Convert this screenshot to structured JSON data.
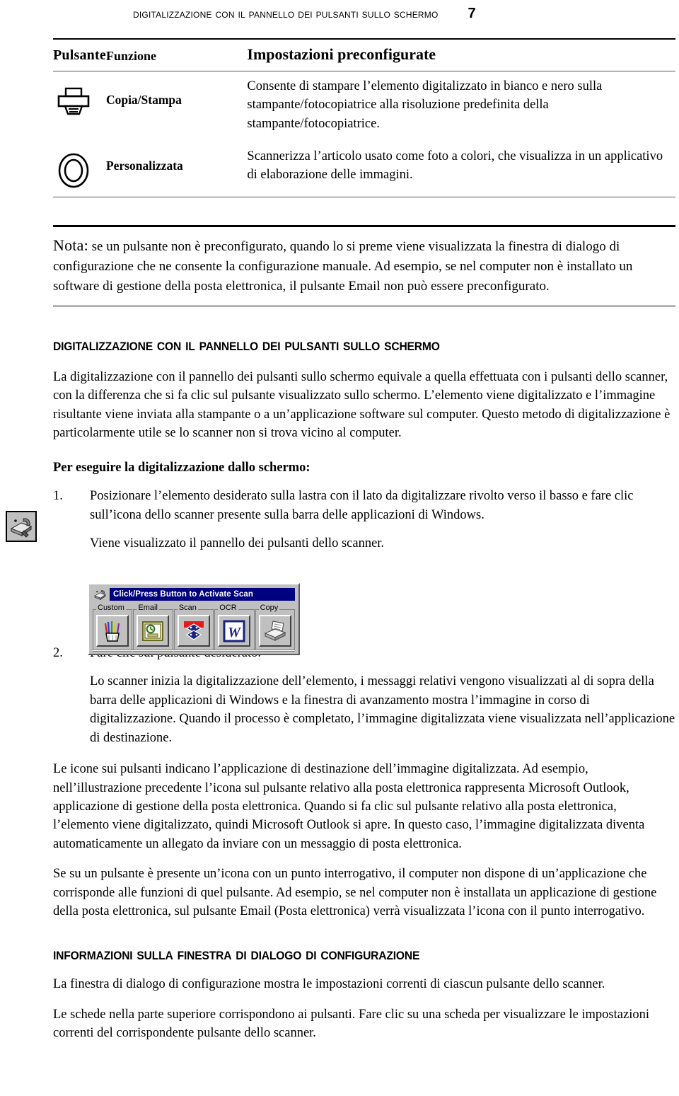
{
  "header": {
    "title": "Digitalizzazione con il pannello dei pulsanti sullo schermo",
    "page_number": "7"
  },
  "table": {
    "headers": {
      "col1": "Pulsante",
      "col2": "Funzione",
      "col3": "Impostazioni preconfigurate"
    },
    "rows": [
      {
        "icon": "printer-icon",
        "function": "Copia/Stampa",
        "description": "Consente di stampare l’elemento digitalizzato in bianco e nero sulla stampante/fotocopiatrice alla risoluzione predefinita della stampante/fotocopiatrice."
      },
      {
        "icon": "oval-ring-icon",
        "function": "Personalizzata",
        "description": "Scannerizza l’articolo usato come foto a colori, che visualizza in un applicativo di elaborazione delle immagini."
      }
    ]
  },
  "note": {
    "label": "Nota:",
    "text": "se un pulsante non è preconfigurato, quando lo si preme viene visualizzata la finestra di dialogo di configurazione che ne consente la configurazione manuale. Ad esempio, se nel computer non è installato un software di gestione della posta elettronica, il pulsante Email non può essere preconfigurato."
  },
  "section1": {
    "heading": "Digitalizzazione con il pannello dei pulsanti sullo schermo",
    "paragraph": "La digitalizzazione con il pannello dei pulsanti sullo schermo equivale a quella effettuata con i pulsanti dello scanner, con la differenza che si fa clic sul pulsante visualizzato sullo schermo. L’elemento viene digitalizzato e l’immagine risultante viene inviata alla stampante o a un’applicazione software sul computer. Questo metodo di digitalizzazione è particolarmente utile se lo scanner non si trova vicino al computer.",
    "lead_in": "Per eseguire la digitalizzazione dallo schermo:",
    "steps": [
      {
        "number": "1.",
        "text": "Posizionare l’elemento desiderato sulla lastra con il lato da digitalizzare rivolto verso il basso e fare clic sull’icona dello scanner presente sulla barra delle applicazioni di Windows.",
        "follow_up": "Viene visualizzato il pannello dei pulsanti dello scanner."
      },
      {
        "number": "2.",
        "text": "Fare clic sul pulsante desiderato.",
        "follow_up": "Lo scanner inizia la digitalizzazione dell’elemento, i messaggi relativi vengono visualizzati al di sopra della barra delle applicazioni di Windows e la finestra di avanzamento mostra l’immagine in corso di digitalizzazione. Quando il processo è completato, l’immagine digitalizzata viene visualizzata nell’applicazione di destinazione."
      }
    ],
    "paragraph_icons": "Le icone sui pulsanti indicano l’applicazione di destinazione dell’immagine digitalizzata. Ad esempio, nell’illustrazione precedente l’icona sul pulsante relativo alla posta elettronica rappresenta Microsoft Outlook, applicazione di gestione della posta elettronica. Quando si fa clic sul pulsante relativo alla posta elettronica, l’elemento viene digitalizzato, quindi Microsoft Outlook si apre. In questo caso, l’immagine digitalizzata diventa automaticamente un allegato da inviare con un messaggio di posta elettronica.",
    "paragraph_question": "Se su un pulsante è presente un’icona con un punto interrogativo, il computer non dispone di un’applicazione che corrisponde alle funzioni di quel pulsante. Ad esempio, se nel computer non è installata un applicazione di gestione della posta elettronica, sul pulsante Email (Posta elettronica) verrà visualizzata l’icona con il punto interrogativo."
  },
  "section2": {
    "heading": "Informazioni sulla finestra di dialogo di configurazione",
    "paragraph1": "La finestra di dialogo di configurazione mostra le impostazioni correnti di ciascun pulsante dello scanner.",
    "paragraph2": "Le schede nella parte superiore corrispondono ai pulsanti. Fare clic su una scheda per visualizzare le impostazioni correnti del corrispondente pulsante dello scanner."
  },
  "margin_icon": {
    "name": "scanner-taskbar-icon"
  },
  "scan_panel": {
    "titlebar": "Click/Press Button to Activate Scan",
    "titlebar_color": "#000080",
    "face_color": "#c0c0c0",
    "buttons": [
      {
        "label": "Custom",
        "icon": "pencil-cup-icon"
      },
      {
        "label": "Email",
        "icon": "outlook-icon"
      },
      {
        "label": "Scan",
        "icon": "imaging-windows-icon"
      },
      {
        "label": "OCR",
        "icon": "word-w-icon"
      },
      {
        "label": "Copy",
        "icon": "printer-copy-icon"
      }
    ]
  }
}
